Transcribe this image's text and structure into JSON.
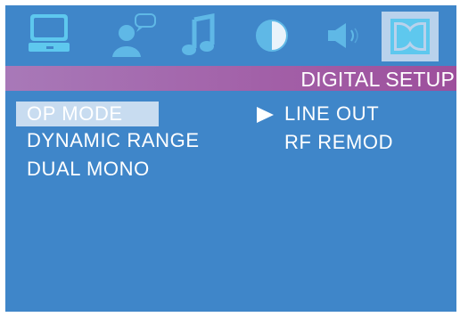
{
  "iconbar": {
    "icons": [
      {
        "name": "general-setup-icon",
        "glyph": "monitor"
      },
      {
        "name": "speaker-setup-icon",
        "glyph": "person-with-speech"
      },
      {
        "name": "audio-setup-icon",
        "glyph": "music-note"
      },
      {
        "name": "video-setup-icon",
        "glyph": "contrast-circle"
      },
      {
        "name": "speaker-volume-icon",
        "glyph": "speaker"
      },
      {
        "name": "digital-setup-icon",
        "glyph": "dolby-double-d",
        "selected": true
      }
    ]
  },
  "header": {
    "title": "DIGITAL SETUP"
  },
  "menu": {
    "items": [
      {
        "label": "OP MODE",
        "highlighted": true
      },
      {
        "label": "DYNAMIC RANGE"
      },
      {
        "label": "DUAL MONO"
      }
    ]
  },
  "options": {
    "items": [
      {
        "label": "LINE OUT",
        "selected": true
      },
      {
        "label": "RF REMOD"
      }
    ]
  },
  "colors": {
    "background": "#3f86c9",
    "title_bar": "#a25fa7",
    "highlight": "#c8dcf0",
    "icon_active": "#5ec8ee",
    "text": "#ffffff"
  }
}
